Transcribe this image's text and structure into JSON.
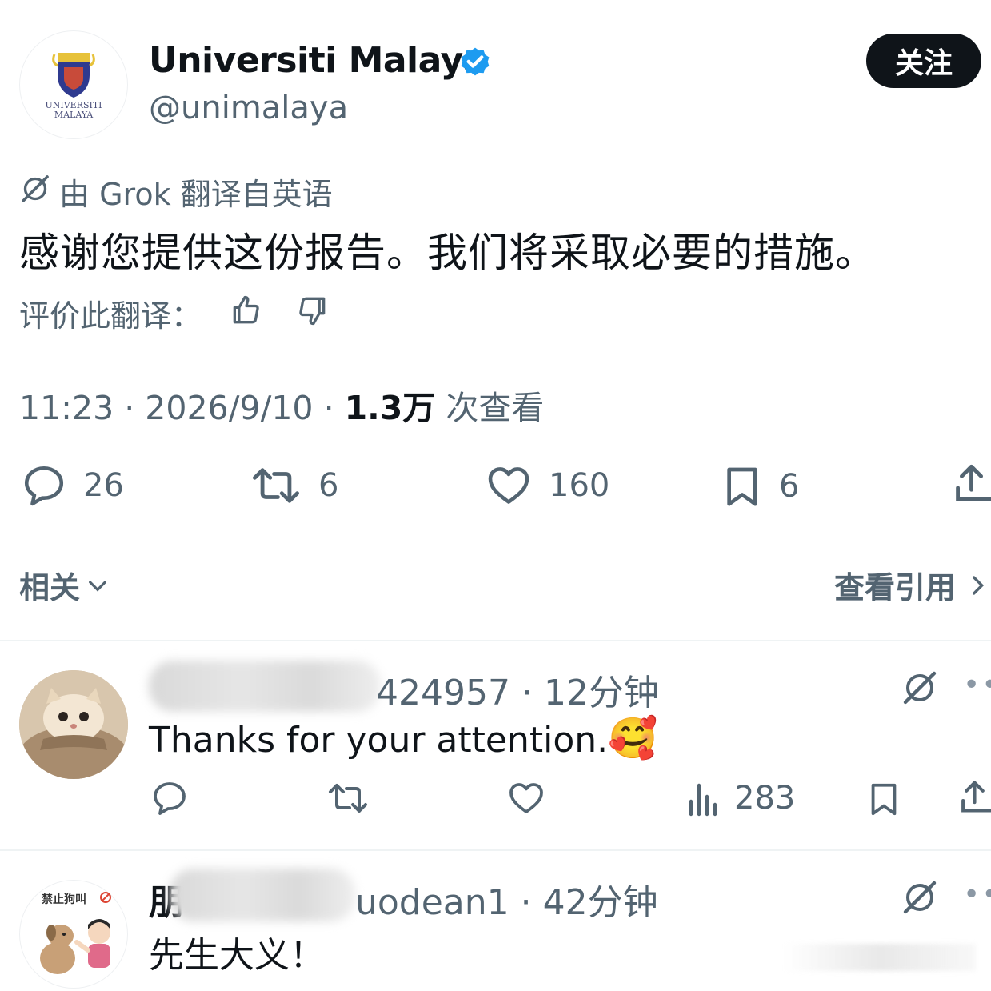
{
  "header": {
    "account_name": "Universiti Malaya",
    "handle": "@unimalaya",
    "follow_label": "关注",
    "avatar_text_line1": "UNIVERSITI",
    "avatar_text_line2": "MALAYA"
  },
  "translation": {
    "note": "由 Grok 翻译自英语",
    "text": "感谢您提供这份报告。我们将采取必要的措施。",
    "rate_label": "评价此翻译："
  },
  "meta": {
    "time": "11:23",
    "date": "2026/9/10",
    "views_count": "1.3万",
    "views_label": "次查看"
  },
  "actions": {
    "replies": "26",
    "reposts": "6",
    "likes": "160",
    "bookmarks": "6"
  },
  "related": {
    "label": "相关",
    "quotes_label": "查看引用"
  },
  "replies": [
    {
      "handle_suffix": "424957",
      "time_ago": "12分钟",
      "text": "Thanks for your attention.",
      "emoji": "🥰",
      "views": "283"
    },
    {
      "name_prefix": "朋",
      "handle_suffix": "uodean1",
      "time_ago": "42分钟",
      "text": "先生大义！",
      "avatar_caption": "禁止狗叫"
    }
  ],
  "colors": {
    "text": "#0f1419",
    "secondary": "#536471",
    "verified_blue": "#1d9bf0",
    "divider": "#eff3f4"
  }
}
